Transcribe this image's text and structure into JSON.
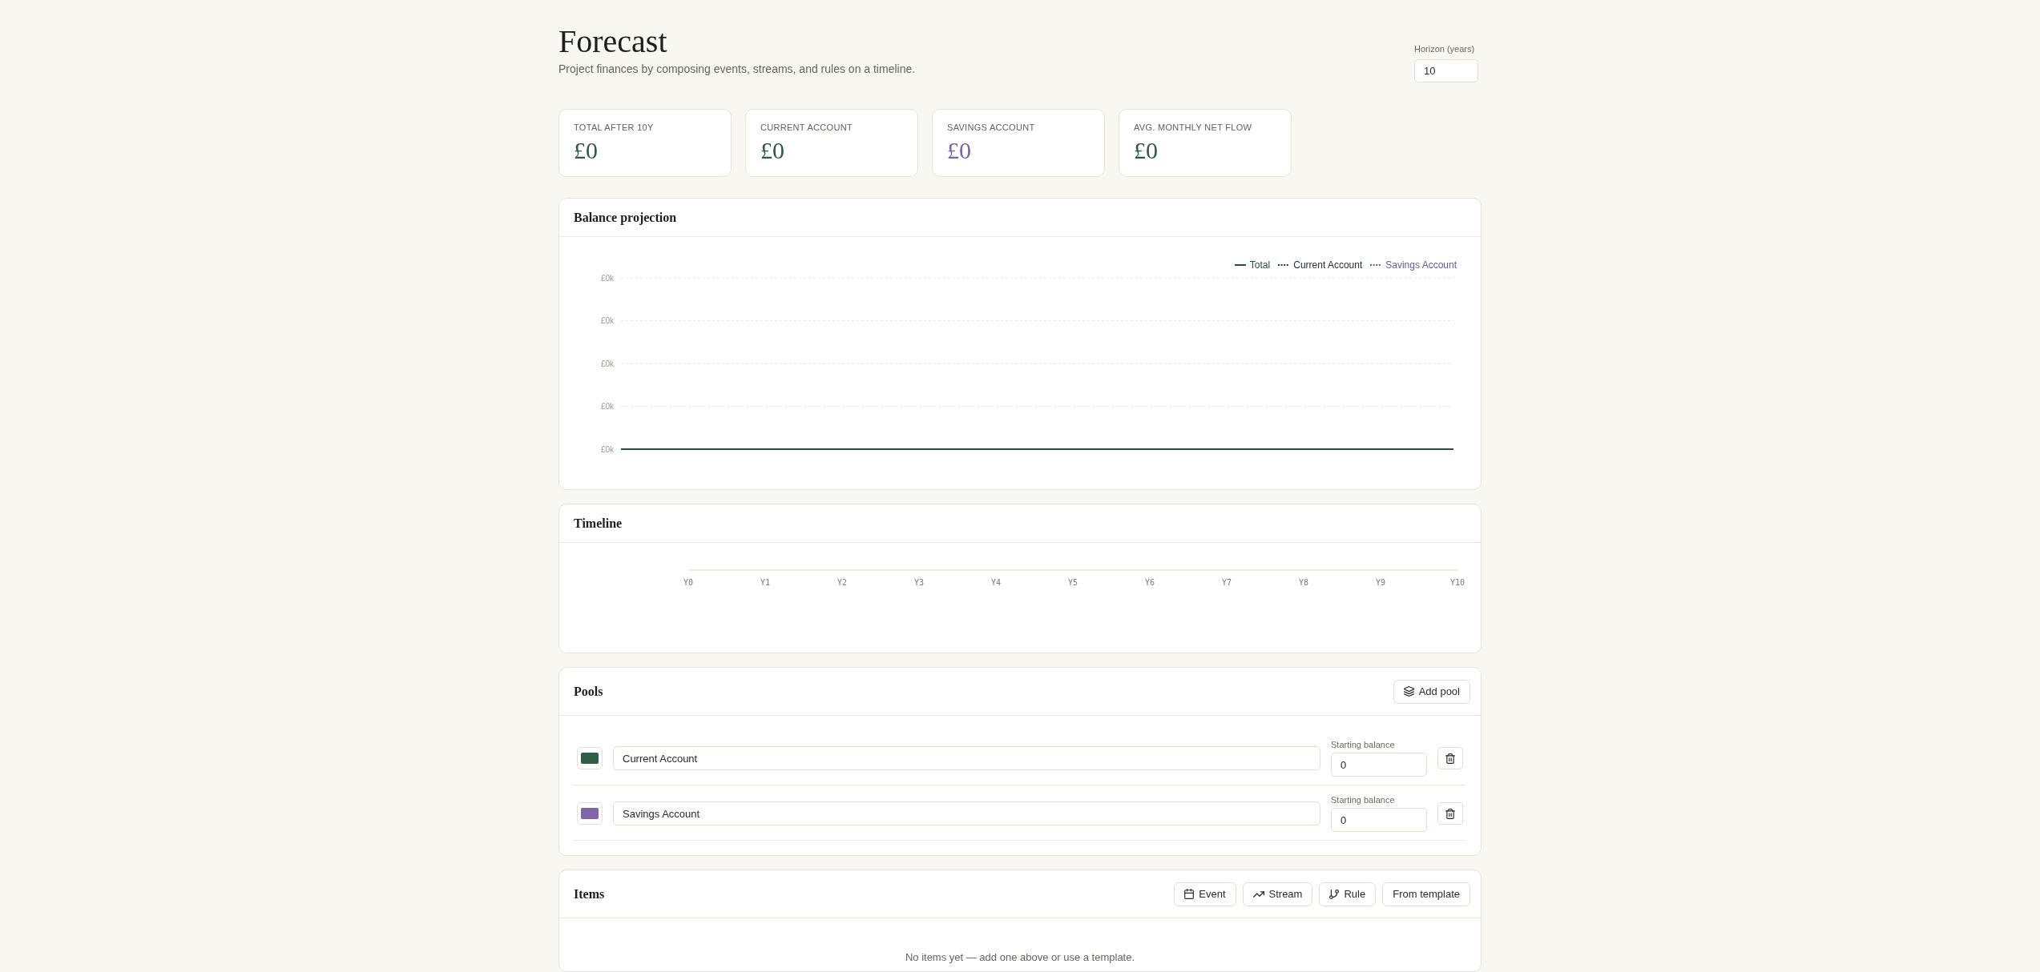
{
  "header": {
    "title": "Forecast",
    "subtitle": "Project finances by composing events, streams, and rules on a timeline.",
    "horizon": {
      "label": "Horizon (years)",
      "value": "10"
    }
  },
  "stats": [
    {
      "label": "TOTAL AFTER 10Y",
      "value": "£0",
      "color": "#2f5a45"
    },
    {
      "label": "CURRENT ACCOUNT",
      "value": "£0",
      "color": "#2f5a45"
    },
    {
      "label": "SAVINGS ACCOUNT",
      "value": "£0",
      "color": "#7d62a6"
    },
    {
      "label": "AVG. MONTHLY NET FLOW",
      "value": "£0",
      "color": "#2f5a45"
    }
  ],
  "balance_projection": {
    "title": "Balance projection",
    "legend": [
      {
        "label": "Total",
        "color": "#244f3c",
        "dotted": false
      },
      {
        "label": "Current Account",
        "color": "#26323a",
        "dotted": true
      },
      {
        "label": "Savings Account",
        "color": "#5f5f9e",
        "dotted": true
      }
    ],
    "y_axis_labels": [
      "£0k",
      "£0k",
      "£0k",
      "£0k",
      "£0k"
    ]
  },
  "timeline": {
    "title": "Timeline",
    "year_labels": [
      "Y0",
      "Y1",
      "Y2",
      "Y3",
      "Y4",
      "Y5",
      "Y6",
      "Y7",
      "Y8",
      "Y9",
      "Y10"
    ]
  },
  "pools": {
    "title": "Pools",
    "add_button": "Add pool",
    "rows": [
      {
        "name": "Current Account",
        "color": "#2e5e45",
        "balance_label": "Starting balance",
        "starting_balance": "0"
      },
      {
        "name": "Savings Account",
        "color": "#8264a8",
        "balance_label": "Starting balance",
        "starting_balance": "0"
      }
    ]
  },
  "items": {
    "title": "Items",
    "buttons": [
      {
        "label": "Event",
        "kind": "event"
      },
      {
        "label": "Stream",
        "kind": "stream"
      },
      {
        "label": "Rule",
        "kind": "rule"
      },
      {
        "label": "From template",
        "kind": "template"
      }
    ],
    "empty_message": "No items yet — add one above or use a template."
  }
}
